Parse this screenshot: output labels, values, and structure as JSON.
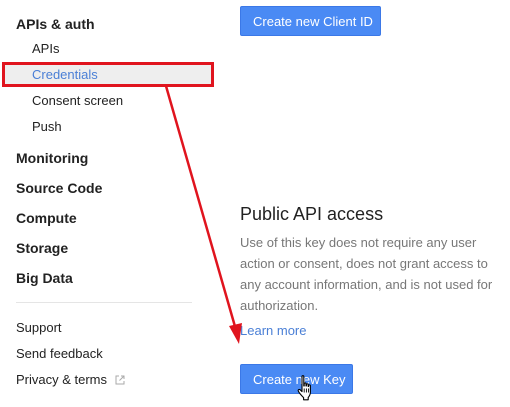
{
  "sidebar": {
    "apis_auth": {
      "title": "APIs & auth",
      "items": [
        {
          "label": "APIs"
        },
        {
          "label": "Credentials"
        },
        {
          "label": "Consent screen"
        },
        {
          "label": "Push"
        }
      ],
      "active_item": "Credentials"
    },
    "sections": [
      {
        "label": "Monitoring"
      },
      {
        "label": "Source Code"
      },
      {
        "label": "Compute"
      },
      {
        "label": "Storage"
      },
      {
        "label": "Big Data"
      }
    ],
    "footer": [
      {
        "label": "Support"
      },
      {
        "label": "Send feedback"
      },
      {
        "label": "Privacy & terms",
        "icon": "external-link-icon"
      }
    ]
  },
  "main": {
    "create_client_id_label": "Create new Client ID",
    "public_api": {
      "heading": "Public API access",
      "description": "Use of this key does not require any user action or consent, does not grant access to any account information, and is not used for authorization.",
      "learn_more": "Learn more",
      "create_key_label": "Create new Key"
    }
  },
  "annotations": {
    "highlight_color": "#e0141e",
    "arrow_color": "#e0141e",
    "cursor_icon": "hand-pointer-icon"
  },
  "colors": {
    "primary_button": "#4a8af4",
    "link": "#4a7fd6",
    "muted_text": "#777777"
  }
}
